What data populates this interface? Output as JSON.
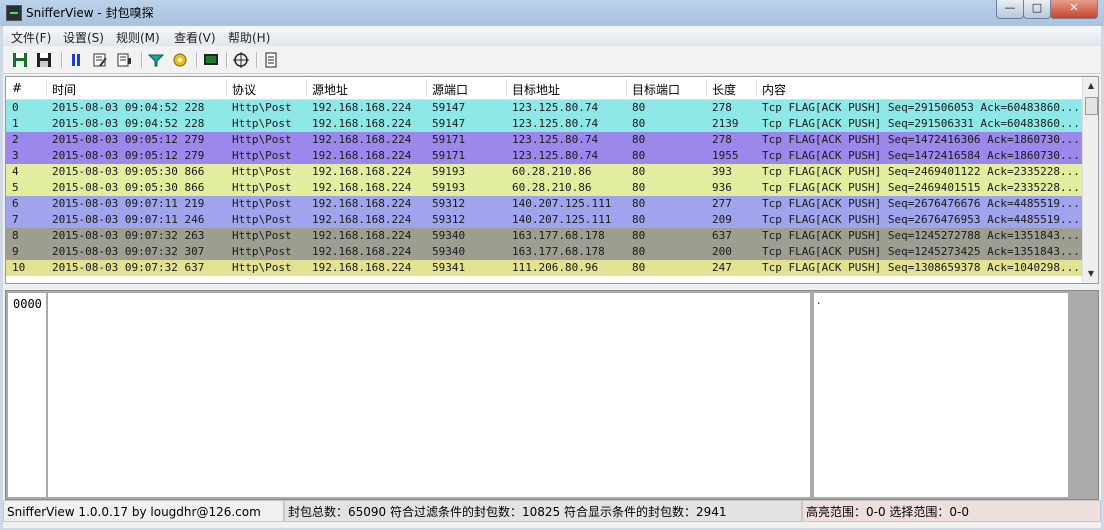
{
  "window": {
    "title": "SnifferView - 封包嗅探"
  },
  "menu": [
    "文件(F)",
    "设置(S)",
    "规则(M)",
    "查看(V)",
    "帮助(H)"
  ],
  "toolbar": [
    "save-icon",
    "save-as-icon",
    "pause-icon",
    "edit-rule-icon",
    "export-icon",
    "filter-icon",
    "settings-icon",
    "terminal-icon",
    "target-icon",
    "document-icon"
  ],
  "table": {
    "columns": [
      "#",
      "时间",
      "协议",
      "源地址",
      "源端口",
      "目标地址",
      "目标端口",
      "长度",
      "内容"
    ],
    "rows": [
      {
        "cells": [
          "0",
          "2015-08-03 09:04:52 228",
          "Http\\Post",
          "192.168.168.224",
          "59147",
          "123.125.80.74",
          "80",
          "278",
          "Tcp FLAG[ACK PUSH] Seq=291506053 Ack=60483860..."
        ],
        "color": "#8ee8e8"
      },
      {
        "cells": [
          "1",
          "2015-08-03 09:04:52 228",
          "Http\\Post",
          "192.168.168.224",
          "59147",
          "123.125.80.74",
          "80",
          "2139",
          "Tcp FLAG[ACK PUSH] Seq=291506331 Ack=60483860..."
        ],
        "color": "#8ee8e8"
      },
      {
        "cells": [
          "2",
          "2015-08-03 09:05:12 279",
          "Http\\Post",
          "192.168.168.224",
          "59171",
          "123.125.80.74",
          "80",
          "278",
          "Tcp FLAG[ACK PUSH] Seq=1472416306 Ack=1860730..."
        ],
        "color": "#9b88ea"
      },
      {
        "cells": [
          "3",
          "2015-08-03 09:05:12 279",
          "Http\\Post",
          "192.168.168.224",
          "59171",
          "123.125.80.74",
          "80",
          "1955",
          "Tcp FLAG[ACK PUSH] Seq=1472416584 Ack=1860730..."
        ],
        "color": "#9b88ea"
      },
      {
        "cells": [
          "4",
          "2015-08-03 09:05:30 866",
          "Http\\Post",
          "192.168.168.224",
          "59193",
          "60.28.210.86",
          "80",
          "393",
          "Tcp FLAG[ACK PUSH] Seq=2469401122 Ack=2335228..."
        ],
        "color": "#e3eda0"
      },
      {
        "cells": [
          "5",
          "2015-08-03 09:05:30 866",
          "Http\\Post",
          "192.168.168.224",
          "59193",
          "60.28.210.86",
          "80",
          "936",
          "Tcp FLAG[ACK PUSH] Seq=2469401515 Ack=2335228..."
        ],
        "color": "#e3eda0"
      },
      {
        "cells": [
          "6",
          "2015-08-03 09:07:11 219",
          "Http\\Post",
          "192.168.168.224",
          "59312",
          "140.207.125.111",
          "80",
          "277",
          "Tcp FLAG[ACK PUSH] Seq=2676476676 Ack=4485519..."
        ],
        "color": "#a0a4ec"
      },
      {
        "cells": [
          "7",
          "2015-08-03 09:07:11 246",
          "Http\\Post",
          "192.168.168.224",
          "59312",
          "140.207.125.111",
          "80",
          "209",
          "Tcp FLAG[ACK PUSH] Seq=2676476953 Ack=4485519..."
        ],
        "color": "#a0a4ec"
      },
      {
        "cells": [
          "8",
          "2015-08-03 09:07:32 263",
          "Http\\Post",
          "192.168.168.224",
          "59340",
          "163.177.68.178",
          "80",
          "637",
          "Tcp FLAG[ACK PUSH] Seq=1245272788 Ack=1351843..."
        ],
        "color": "#9e9e90"
      },
      {
        "cells": [
          "9",
          "2015-08-03 09:07:32 307",
          "Http\\Post",
          "192.168.168.224",
          "59340",
          "163.177.68.178",
          "80",
          "200",
          "Tcp FLAG[ACK PUSH] Seq=1245273425 Ack=1351843..."
        ],
        "color": "#9e9e90"
      },
      {
        "cells": [
          "10",
          "2015-08-03 09:07:32 637",
          "Http\\Post",
          "192.168.168.224",
          "59341",
          "111.206.80.96",
          "80",
          "247",
          "Tcp FLAG[ACK PUSH] Seq=1308659378 Ack=1040298..."
        ],
        "color": "#e2e292"
      }
    ]
  },
  "hex": {
    "offset": "0000",
    "ascii": "."
  },
  "status": {
    "app": "SnifferView  1.0.0.17   by   lougdhr@126.com",
    "counts": "封包总数：65090  符合过滤条件的封包数：10825  符合显示条件的封包数：2941",
    "ranges": "高亮范围：0-0  选择范围：0-0"
  }
}
